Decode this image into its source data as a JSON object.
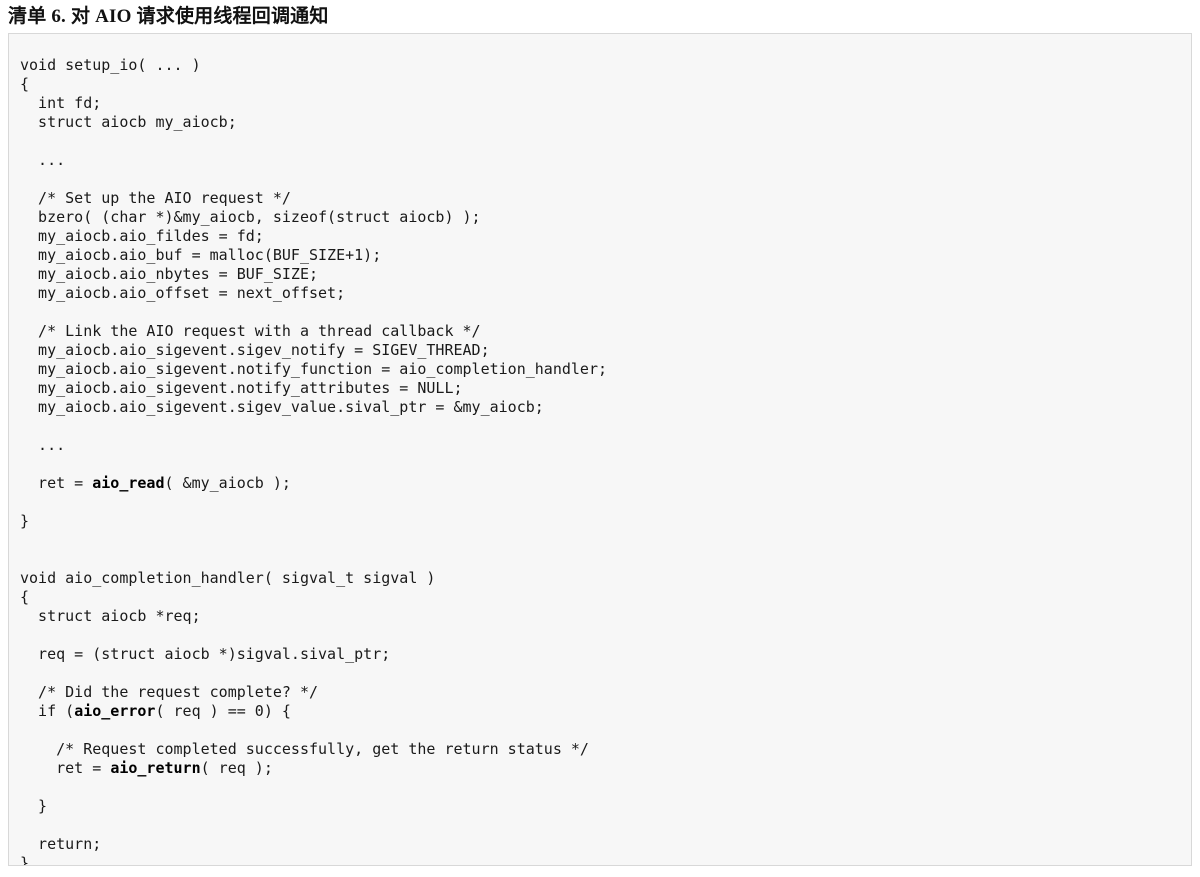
{
  "listing": {
    "title": "清单 6. 对 AIO 请求使用线程回调通知",
    "title_parts": {
      "label": "清单",
      "number": "6.",
      "text_before_acronym": "对",
      "acronym": "AIO",
      "text_after_acronym": "请求使用线程回调通知"
    },
    "language": "c",
    "colors": {
      "code_background": "#f7f7f7",
      "code_border": "#d8d8d8",
      "page_background": "#ffffff",
      "text": "#1a1a1a",
      "title_text": "#111111"
    },
    "code_lines": [
      "void setup_io( ... )",
      "{",
      "  int fd;",
      "  struct aiocb my_aiocb;",
      "",
      "  ...",
      "",
      "  /* Set up the AIO request */",
      "  bzero( (char *)&my_aiocb, sizeof(struct aiocb) );",
      "  my_aiocb.aio_fildes = fd;",
      "  my_aiocb.aio_buf = malloc(BUF_SIZE+1);",
      "  my_aiocb.aio_nbytes = BUF_SIZE;",
      "  my_aiocb.aio_offset = next_offset;",
      "",
      "  /* Link the AIO request with a thread callback */",
      "  my_aiocb.aio_sigevent.sigev_notify = SIGEV_THREAD;",
      "  my_aiocb.aio_sigevent.notify_function = aio_completion_handler;",
      "  my_aiocb.aio_sigevent.notify_attributes = NULL;",
      "  my_aiocb.aio_sigevent.sigev_value.sival_ptr = &my_aiocb;",
      "",
      "  ...",
      "",
      "  ret = aio_read( &my_aiocb );",
      "",
      "}",
      "",
      "",
      "void aio_completion_handler( sigval_t sigval )",
      "{",
      "  struct aiocb *req;",
      "",
      "  req = (struct aiocb *)sigval.sival_ptr;",
      "",
      "  /* Did the request complete? */",
      "  if (aio_error( req ) == 0) {",
      "",
      "    /* Request completed successfully, get the return status */",
      "    ret = aio_return( req );",
      "",
      "  }",
      "",
      "  return;",
      "}"
    ],
    "bold_tokens": [
      "aio_read",
      "aio_error",
      "aio_return"
    ]
  }
}
